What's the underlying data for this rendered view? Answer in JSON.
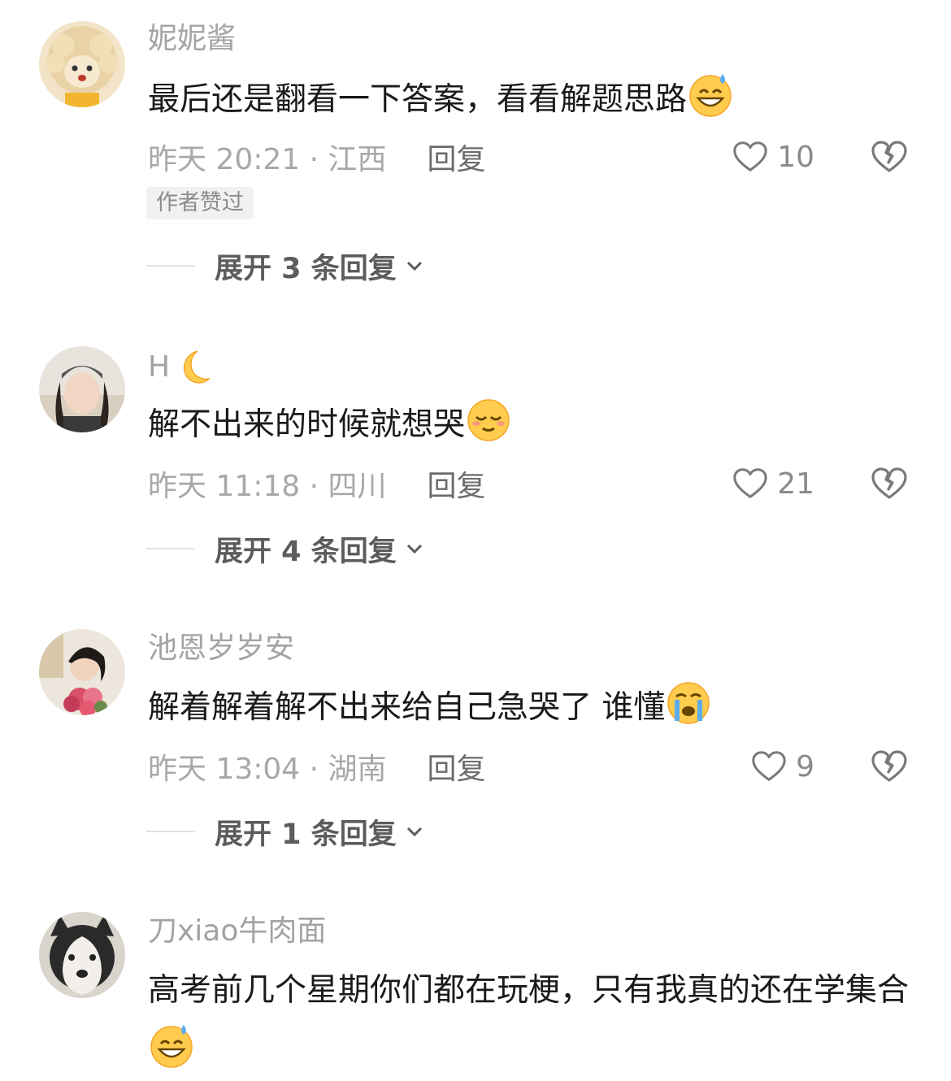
{
  "comments": [
    {
      "username": "妮妮酱",
      "text": "最后还是翻看一下答案，看看解题思路",
      "emoji": "grinning-sweat-emoji",
      "time_location": "昨天 20:21 · 江西",
      "reply_label": "回复",
      "likes": "10",
      "badge": "作者赞过",
      "expand_label": "展开 3 条回复"
    },
    {
      "username": "H",
      "username_emoji": "crescent-moon-emoji",
      "text": "解不出来的时候就想哭",
      "emoji": "relieved-emoji",
      "time_location": "昨天 11:18 · 四川",
      "reply_label": "回复",
      "likes": "21",
      "expand_label": "展开 4 条回复"
    },
    {
      "username": "池恩岁岁安",
      "text": "解着解着解不出来给自己急哭了 谁懂",
      "emoji": "crying-emoji",
      "time_location": "昨天 13:04 · 湖南",
      "reply_label": "回复",
      "likes": "9",
      "expand_label": "展开 1 条回复"
    },
    {
      "username": "刀xiao牛肉面",
      "text": "高考前几个星期你们都在玩梗，只有我真的还在学集合",
      "emoji": "grinning-sweat-emoji"
    }
  ],
  "colors": {
    "text_primary": "#1a1a1a",
    "text_secondary": "#a3a3a3",
    "badge_bg": "#f1f1f1"
  }
}
